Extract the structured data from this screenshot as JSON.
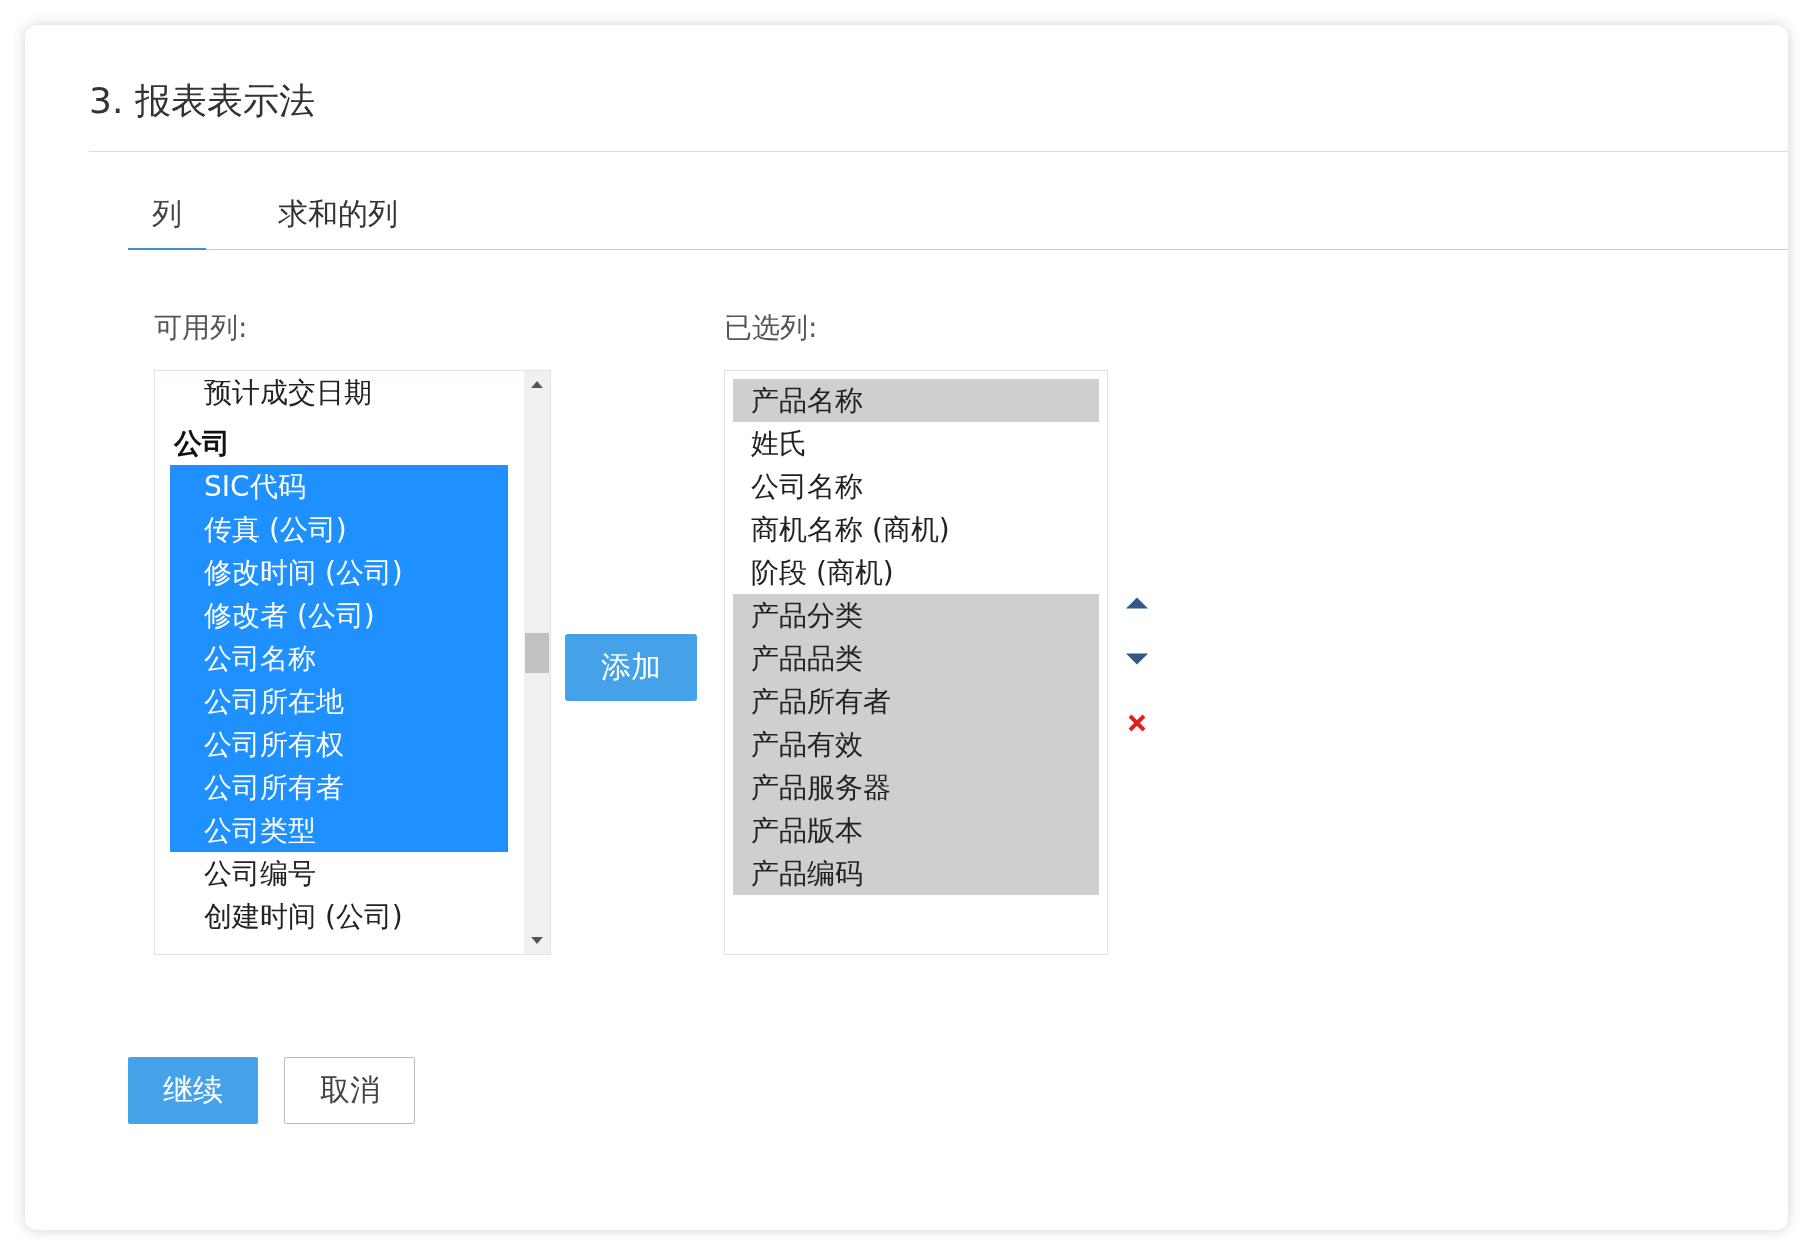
{
  "section_title": "3. 报表表示法",
  "tabs": [
    {
      "label": "列",
      "selected": true
    },
    {
      "label": "求和的列",
      "selected": false
    }
  ],
  "available": {
    "label": "可用列:",
    "items": [
      {
        "kind": "option",
        "label": "预计成交日期",
        "selected": false
      },
      {
        "kind": "group",
        "label": "公司"
      },
      {
        "kind": "option",
        "label": "SIC代码",
        "selected": true
      },
      {
        "kind": "option",
        "label": "传真 (公司)",
        "selected": true
      },
      {
        "kind": "option",
        "label": "修改时间 (公司)",
        "selected": true
      },
      {
        "kind": "option",
        "label": "修改者 (公司)",
        "selected": true
      },
      {
        "kind": "option",
        "label": "公司名称",
        "selected": true
      },
      {
        "kind": "option",
        "label": "公司所在地",
        "selected": true
      },
      {
        "kind": "option",
        "label": "公司所有权",
        "selected": true
      },
      {
        "kind": "option",
        "label": "公司所有者",
        "selected": true
      },
      {
        "kind": "option",
        "label": "公司类型",
        "selected": true
      },
      {
        "kind": "option",
        "label": "公司编号",
        "selected": false
      },
      {
        "kind": "option",
        "label": "创建时间 (公司)",
        "selected": false
      }
    ]
  },
  "add_button": "添加",
  "chosen": {
    "label": "已选列:",
    "items": [
      {
        "label": "产品名称",
        "selected": true
      },
      {
        "label": "姓氏",
        "selected": false
      },
      {
        "label": "公司名称",
        "selected": false
      },
      {
        "label": "商机名称 (商机)",
        "selected": false
      },
      {
        "label": "阶段 (商机)",
        "selected": false
      },
      {
        "label": "产品分类",
        "selected": true
      },
      {
        "label": "产品品类",
        "selected": true
      },
      {
        "label": "产品所有者",
        "selected": true
      },
      {
        "label": "产品有效",
        "selected": true
      },
      {
        "label": "产品服务器",
        "selected": true
      },
      {
        "label": "产品版本",
        "selected": true
      },
      {
        "label": "产品编码",
        "selected": true
      }
    ]
  },
  "buttons": [
    {
      "kind": "primary",
      "label": "继续"
    },
    {
      "kind": "secondary",
      "label": "取消"
    }
  ]
}
